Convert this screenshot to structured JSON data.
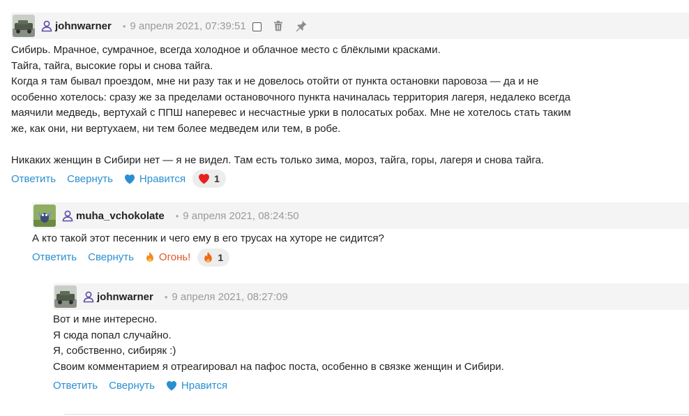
{
  "comments": [
    {
      "username": "johnwarner",
      "date": "9 апреля 2021, 07:39:51",
      "lines": [
        "Сибирь. Мрачное, сумрачное, всегда холодное и облачное место с блёклыми красками.",
        "Тайга, тайга, высокие горы и снова тайга.",
        "Когда я там бывал проездом, мне ни разу так и не довелось отойти от пункта остановки паровоза — да и не",
        "особенно хотелось: сразу же за пределами остановочного пункта начиналась территория лагеря, недалеко всегда",
        "маячили медведь, вертухай с ППШ наперевес и несчастные урки в полосатых робах. Мне не хотелось стать таким",
        "же, как они, ни вертухаем, ни тем более медведем или тем, в робе.",
        "",
        "Никаких женщин в Сибири нет — я не видел. Там есть только зима, мороз, тайга, горы, лагеря и снова тайга."
      ],
      "reply": "Ответить",
      "collapse": "Свернуть",
      "reaction_label": "Нравится",
      "reaction_count": "1"
    },
    {
      "username": "muha_vchokolate",
      "date": "9 апреля 2021, 08:24:50",
      "lines": [
        "А кто такой этот песенник и чего ему в его трусах на хуторе не сидится?"
      ],
      "reply": "Ответить",
      "collapse": "Свернуть",
      "reaction_label": "Огонь!",
      "reaction_count": "1"
    },
    {
      "username": "johnwarner",
      "date": "9 апреля 2021, 08:27:09",
      "lines": [
        "Вот и мне интересно.",
        "Я сюда попал случайно.",
        "Я, собственно, сибиряк :)",
        "Своим комментарием я отреагировал на пафос поста, особенно в связке женщин и Сибири."
      ],
      "reply": "Ответить",
      "collapse": "Свернуть",
      "reaction_label": "Нравится"
    }
  ],
  "icons": {
    "user": "user-icon",
    "trash": "trash-icon",
    "pin": "pin-icon",
    "like": "heart-icon",
    "fire": "fire-icon"
  },
  "colors": {
    "link": "#2a8fd0",
    "fire": "#e0552a",
    "heart": "#e52222",
    "header_bg": "#f4f4f4"
  }
}
